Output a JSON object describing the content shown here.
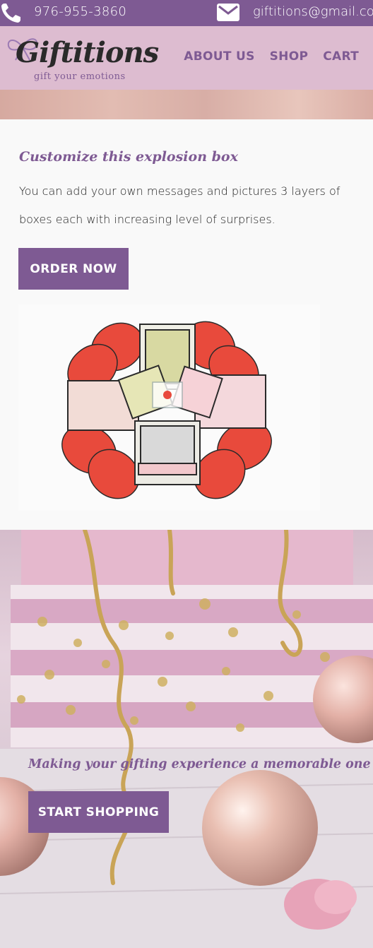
{
  "topbar": {
    "phone": "976-955-3860",
    "email": "giftitions@gmail.com",
    "phone_icon": "phone-icon",
    "mail_icon": "envelope-icon"
  },
  "header": {
    "brand": "Giftitions",
    "tagline": "gift your emotions",
    "nav": [
      "ABOUT US",
      "SHOP",
      "CART"
    ]
  },
  "product": {
    "headline": "Customize this explosion box",
    "description": "You can add your own messages and pictures 3 layers of boxes each with increasing level of surprises.",
    "order_label": "ORDER NOW"
  },
  "hero": {
    "tagline": "Making your gifting experience a memorable one",
    "shop_label": "START SHOPPING"
  },
  "colors": {
    "accent": "#7e5a93",
    "header_bg": "#ddbcd0",
    "page_bg": "#f9f9f9"
  }
}
